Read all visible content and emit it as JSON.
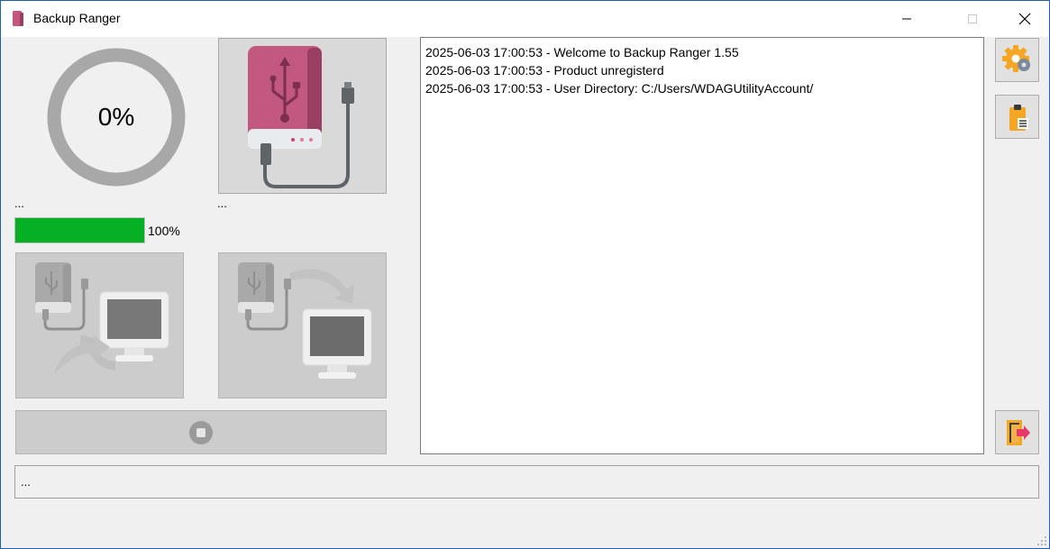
{
  "window": {
    "title": "Backup Ranger",
    "controls": {
      "minimize": "—",
      "maximize": "☐",
      "close": "✕"
    }
  },
  "progress_ring": {
    "label": "0%",
    "value_percent": 0
  },
  "drive": {
    "status_text": "..."
  },
  "task": {
    "status_text": "..."
  },
  "progress_bar": {
    "label": "100%",
    "value_percent": 100,
    "fill_color": "#06b025"
  },
  "log": {
    "lines": [
      "2025-06-03 17:00:53 - Welcome to Backup Ranger 1.55",
      "2025-06-03 17:00:53 - Product unregisterd",
      "2025-06-03 17:00:53 - User Directory: C:/Users/WDAGUtilityAccount/"
    ]
  },
  "status_bar": {
    "text": "..."
  },
  "colors": {
    "accent": "#1e5fb4",
    "drive_body": "#c2587f",
    "progress_green": "#06b025",
    "exit_arrow": "#e6396a",
    "button_gray": "#cccccc"
  }
}
